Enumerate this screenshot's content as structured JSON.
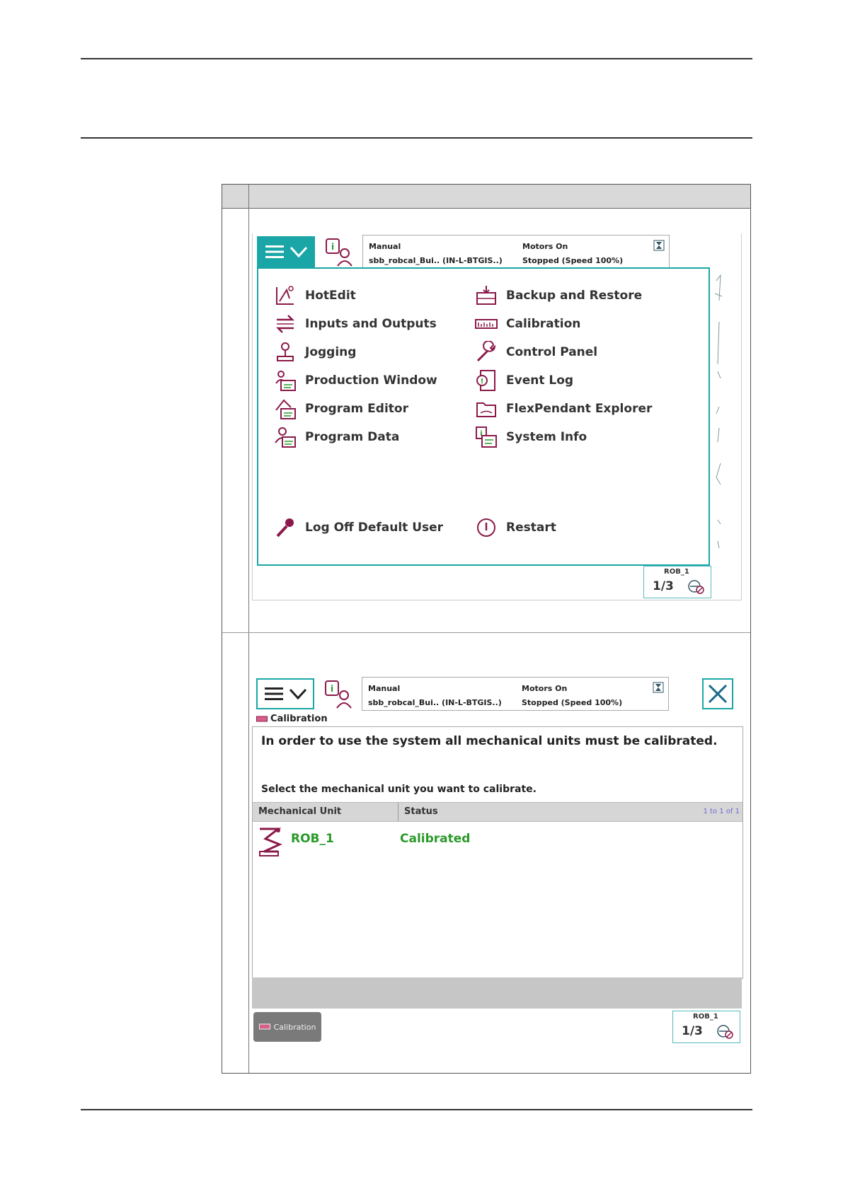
{
  "colors": {
    "accent": "#1aa6a6",
    "icon": "#8b1a4a",
    "calibrated": "#2a9a2a"
  },
  "screen1": {
    "status": {
      "mode": "Manual",
      "system": "sbb_robcal_Bui.. (IN-L-BTGIS..)",
      "motors": "Motors On",
      "state": "Stopped (Speed 100%)"
    },
    "menu": {
      "left": [
        "HotEdit",
        "Inputs and Outputs",
        "Jogging",
        "Production Window",
        "Program Editor",
        "Program Data"
      ],
      "right": [
        "Backup and Restore",
        "Calibration",
        "Control Panel",
        "Event Log",
        "FlexPendant Explorer",
        "System Info"
      ],
      "log_off": "Log Off Default User",
      "restart": "Restart"
    },
    "corner": {
      "unit": "ROB_1",
      "fraction": "1/3"
    }
  },
  "screen2": {
    "status": {
      "mode": "Manual",
      "system": "sbb_robcal_Bui.. (IN-L-BTGIS..)",
      "motors": "Motors On",
      "state": "Stopped (Speed 100%)"
    },
    "title": "Calibration",
    "message": "In order to use the system all mechanical units must be calibrated.",
    "instruction": "Select the mechanical unit you want to calibrate.",
    "columns": {
      "unit": "Mechanical Unit",
      "status": "Status",
      "count": "1 to 1 of 1"
    },
    "rows": [
      {
        "unit": "ROB_1",
        "status": "Calibrated"
      }
    ],
    "task_button": "Calibration",
    "corner": {
      "unit": "ROB_1",
      "fraction": "1/3"
    }
  }
}
